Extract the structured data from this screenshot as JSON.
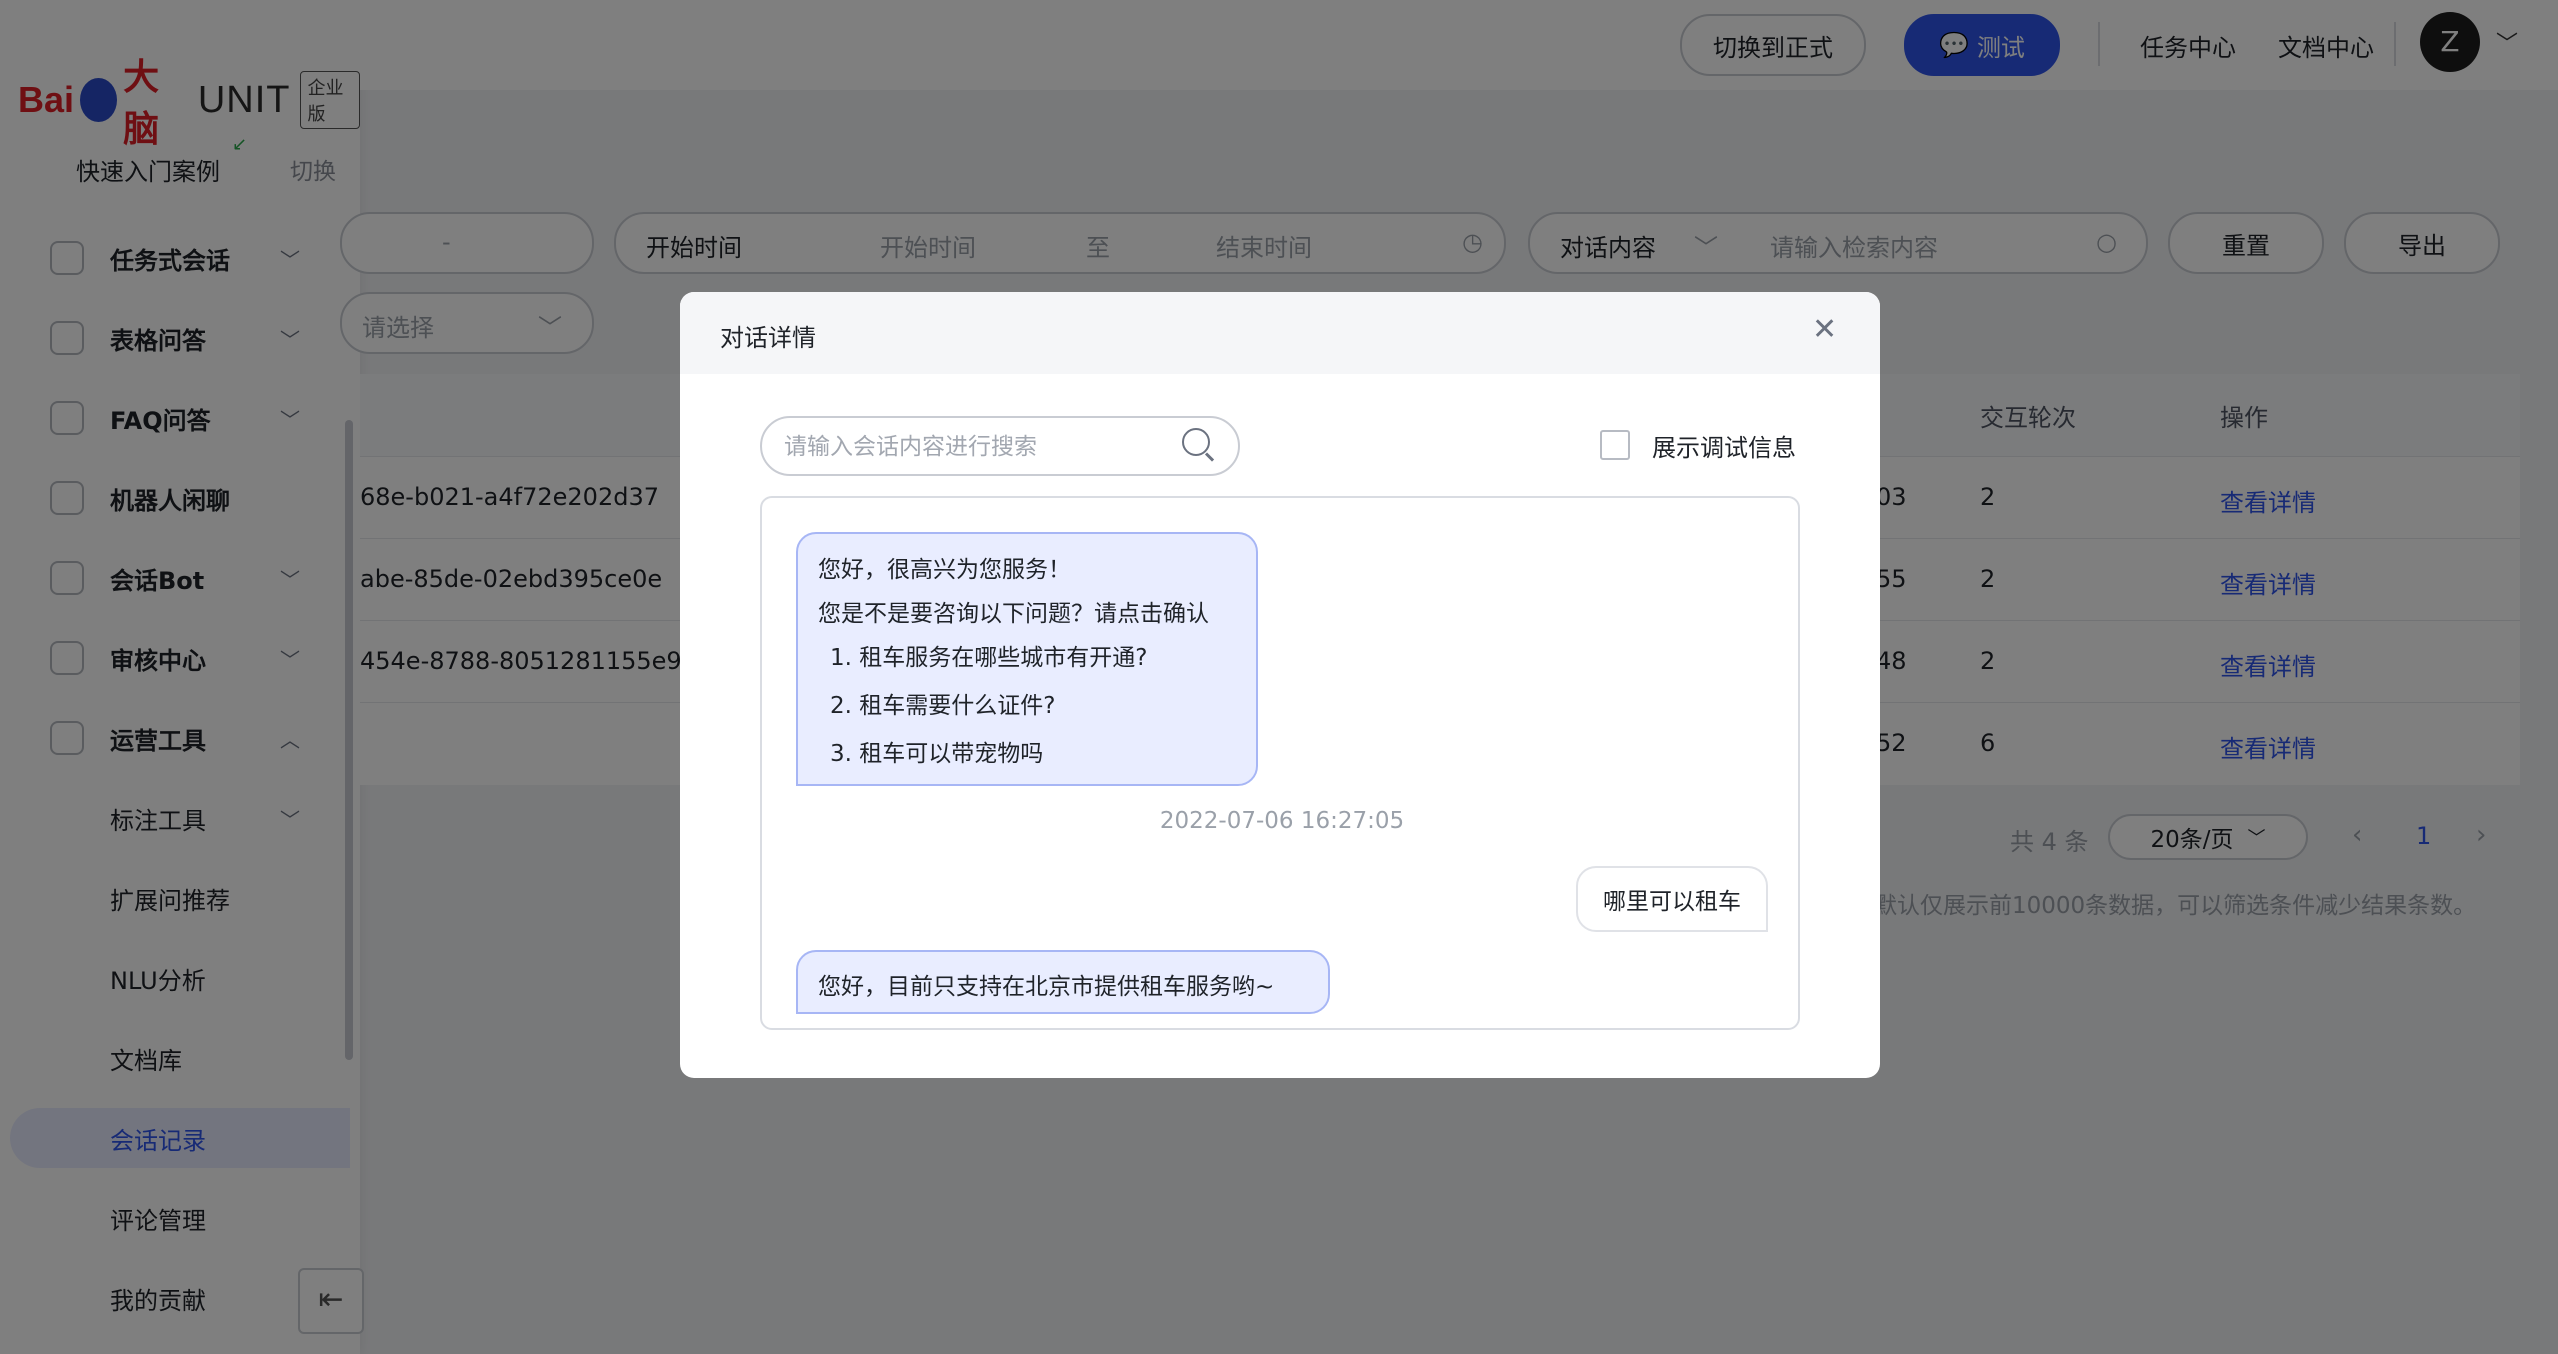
{
  "sidebar": {
    "logo": {
      "bai": "Bai",
      "du": "du",
      "brain": "大脑",
      "unit": "UNIT",
      "edition": "企业版"
    },
    "project": "快速入门案例",
    "switch": "切换",
    "items": [
      {
        "label": "任务式会话",
        "expanded": false
      },
      {
        "label": "表格问答",
        "expanded": false
      },
      {
        "label": "FAQ问答",
        "expanded": false
      },
      {
        "label": "机器人闲聊"
      },
      {
        "label": "会话Bot",
        "expanded": false
      },
      {
        "label": "审核中心",
        "expanded": false
      },
      {
        "label": "运营工具",
        "expanded": true
      }
    ],
    "subitems": [
      {
        "label": "标注工具",
        "expanded": false
      },
      {
        "label": "扩展问推荐"
      },
      {
        "label": "NLU分析"
      },
      {
        "label": "文档库"
      },
      {
        "label": "会话记录",
        "active": true
      },
      {
        "label": "评论管理"
      },
      {
        "label": "我的贡献"
      }
    ]
  },
  "topbar": {
    "switch_formal": "切换到正式",
    "test": "测试",
    "task_center": "任务中心",
    "doc_center": "文档中心",
    "avatar": "Z"
  },
  "filters": {
    "dash": "-",
    "time_label": "开始时间",
    "start_placeholder": "开始时间",
    "to": "至",
    "end_placeholder": "结束时间",
    "content_type": "对话内容",
    "search_placeholder": "请输入检索内容",
    "reset": "重置",
    "export": "导出",
    "select_placeholder": "请选择"
  },
  "table": {
    "headers": {
      "rounds": "交互轮次",
      "ops": "操作"
    },
    "rows": [
      {
        "session": "68e-b021-a4f72e202d37",
        "time_tail": "03",
        "rounds": "2",
        "action": "查看详情"
      },
      {
        "session": "abe-85de-02ebd395ce0e",
        "time_tail": "55",
        "rounds": "2",
        "action": "查看详情"
      },
      {
        "session": "454e-8788-8051281155e9",
        "time_tail": "48",
        "rounds": "2",
        "action": "查看详情"
      },
      {
        "session": "",
        "time_tail": "52",
        "rounds": "6",
        "action": "查看详情"
      }
    ]
  },
  "pagination": {
    "total": "共 4 条",
    "page_size": "20条/页",
    "current": "1"
  },
  "notice": "默认仅展示前10000条数据，可以筛选条件减少结果条数。",
  "modal": {
    "title": "对话详情",
    "search_placeholder": "请输入会话内容进行搜索",
    "debug_label": "展示调试信息",
    "bot_msg1": {
      "greeting": "您好，很高兴为您服务！",
      "prompt": "您是不是要咨询以下问题？请点击确认",
      "options": [
        "1. 租车服务在哪些城市有开通?",
        "2. 租车需要什么证件?",
        "3. 租车可以带宠物吗"
      ]
    },
    "timestamp": "2022-07-06 16:27:05",
    "user_msg": "哪里可以租车",
    "bot_msg2": "您好，目前只支持在北京市提供租车服务哟~"
  }
}
